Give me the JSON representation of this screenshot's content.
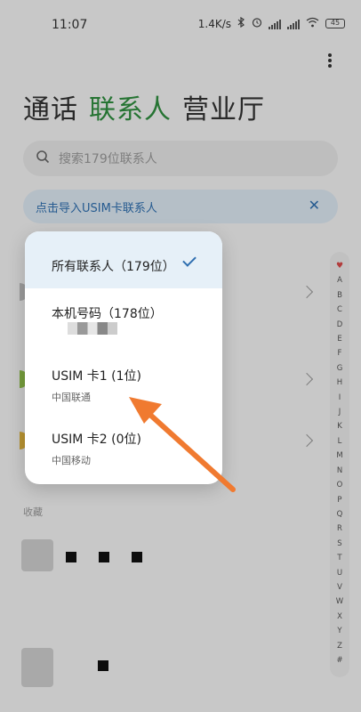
{
  "status_bar": {
    "time": "11:07",
    "speed": "1.4K/s",
    "battery": "45"
  },
  "tabs": [
    {
      "label": "通话"
    },
    {
      "label": "联系人"
    },
    {
      "label": "营业厅"
    }
  ],
  "search": {
    "placeholder": "搜索179位联系人"
  },
  "banner": {
    "text": "点击导入USIM卡联系人",
    "close": "✕"
  },
  "section_label": "收藏",
  "alphabet": [
    "♥",
    "A",
    "B",
    "C",
    "D",
    "E",
    "F",
    "G",
    "H",
    "I",
    "J",
    "K",
    "L",
    "M",
    "N",
    "O",
    "P",
    "Q",
    "R",
    "S",
    "T",
    "U",
    "V",
    "W",
    "X",
    "Y",
    "Z",
    "#"
  ],
  "popup": {
    "items": [
      {
        "title": "所有联系人（179位）",
        "subtitle": "",
        "selected": true
      },
      {
        "title": "本机号码（178位）",
        "subtitle": "",
        "selected": false
      },
      {
        "title": "USIM 卡1 (1位)",
        "subtitle": "中国联通",
        "selected": false
      },
      {
        "title": "USIM 卡2 (0位)",
        "subtitle": "中国移动",
        "selected": false
      }
    ]
  },
  "colors": {
    "accent_green": "#2f8e3f",
    "accent_blue": "#2f6fb0",
    "arrow": "#f07a30"
  }
}
